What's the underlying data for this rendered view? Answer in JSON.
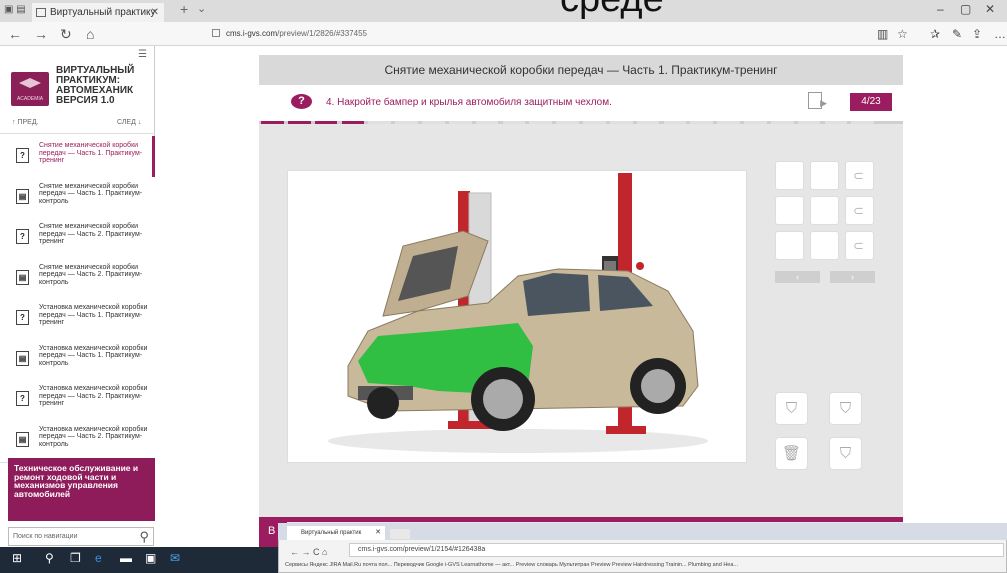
{
  "browser": {
    "tab_title": "Виртуальный практику",
    "tab_close": "✕",
    "new_tab": "+",
    "tab_menu": "⌄",
    "url_host": "cms.i-gvs.com",
    "url_path": "/preview/1/2826/#337455",
    "window_controls": [
      "–",
      "▢",
      "✕"
    ],
    "overlay_heading": "среде"
  },
  "sidebar": {
    "logo_brand": "ACADEMIA",
    "title_lines": [
      "ВИРТУАЛЬНЫЙ",
      "ПРАКТИКУМ:",
      "АВТОМЕХАНИК",
      "ВЕРСИЯ 1.0"
    ],
    "prev_label": "↑ ПРЕД.",
    "next_label": "СЛЕД ↓",
    "items": [
      {
        "icon": "?",
        "label": "Снятие механической коробки передач — Часть 1. Практикум-тренинг",
        "active": true
      },
      {
        "icon": "▤",
        "label": "Снятие механической коробки передач — Часть 1. Практикум-контроль",
        "active": false
      },
      {
        "icon": "?",
        "label": "Снятие механической коробки передач — Часть 2. Практикум-тренинг",
        "active": false
      },
      {
        "icon": "▤",
        "label": "Снятие механической коробки передач — Часть 2. Практикум-контроль",
        "active": false
      },
      {
        "icon": "?",
        "label": "Установка механической коробки передач — Часть 1. Практикум-тренинг",
        "active": false
      },
      {
        "icon": "▤",
        "label": "Установка механической коробки передач — Часть 1. Практикум-контроль",
        "active": false
      },
      {
        "icon": "?",
        "label": "Установка механической коробки передач — Часть 2. Практикум-тренинг",
        "active": false
      },
      {
        "icon": "▤",
        "label": "Установка механической коробки передач — Часть 2. Практикум-контроль",
        "active": false
      }
    ],
    "promo": "Техническое обслуживание и ремонт ходовой части и механизмов управления автомобилей",
    "search_placeholder": "Поиск по навигации"
  },
  "main": {
    "title": "Снятие механической коробки передач — Часть 1. Практикум-тренинг",
    "task_icon": "?",
    "task": "4. Накройте бампер и крылья автомобиля защитным чехлом.",
    "counter": "4/23",
    "progress": {
      "done": 4,
      "total": 23
    },
    "arrow_prev": "‹",
    "arrow_next": "›",
    "bottom_label": "В"
  },
  "overlay_browser": {
    "tab_title": "Виртуальный практик",
    "url": "cms.i-gvs.com/preview/1/2154/#126438a",
    "bookmarks": "Сервисы  Яндекс  JIRA  Mail.Ru почта пол...  Переводчик Google  i-GVS  Learnathome — акт...  Preview  словарь Мультитран  Preview  Preview  Hairdressing Trainin...  Plumbing and Hea..."
  },
  "colors": {
    "accent": "#9b1d5f"
  }
}
